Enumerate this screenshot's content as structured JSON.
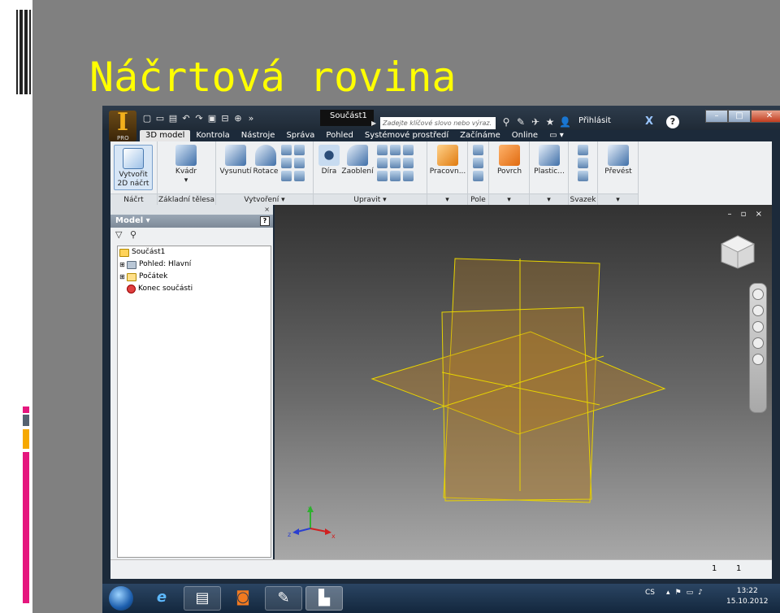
{
  "slide": {
    "title": "Náčrtová rovina"
  },
  "app": {
    "badge": "PRO",
    "doc_title": "Součást1",
    "search_placeholder": "Zadejte klíčové slovo nebo výraz.",
    "signin_label": "Přihlásit",
    "help_label": "?"
  },
  "menu": {
    "tabs": [
      "3D model",
      "Kontrola",
      "Nástroje",
      "Správa",
      "Pohled",
      "Systémové prostředí",
      "Začínáme",
      "Online"
    ],
    "active_index": 0
  },
  "ribbon": {
    "sketch": {
      "btn_line1": "Vytvořit",
      "btn_line2": "2D náčrt",
      "group": "Náčrt"
    },
    "primitives": {
      "btn": "Kvádr",
      "group": "Základní tělesa"
    },
    "create": {
      "extrude": "Vysunutí",
      "revolve": "Rotace",
      "group": "Vytvoření"
    },
    "modify": {
      "hole": "Díra",
      "fillet": "Zaoblení",
      "group": "Upravit"
    },
    "work": {
      "btn": "Pracovn...",
      "group": ""
    },
    "pattern": {
      "group": "Pole"
    },
    "surface": {
      "btn": "Povrch",
      "group": ""
    },
    "plastic": {
      "btn": "Plastic...",
      "group": ""
    },
    "harness": {
      "group": "Svazek"
    },
    "convert": {
      "btn": "Převést",
      "group": ""
    }
  },
  "browser": {
    "pin": "×",
    "header": "Model",
    "help": "?",
    "tree": [
      {
        "label": "Součást1",
        "icon": "part-icon"
      },
      {
        "label": "Pohled: Hlavní",
        "icon": "view-icon"
      },
      {
        "label": "Počátek",
        "icon": "folder-icon"
      },
      {
        "label": "Konec součásti",
        "icon": "end-of-part-icon"
      }
    ]
  },
  "viewport": {
    "window_controls": "– ▫ ×"
  },
  "status": {
    "left": "1",
    "right": "1"
  },
  "taskbar": {
    "lang": "CS",
    "time": "13:22",
    "date": "15.10.2012"
  },
  "colors": {
    "slide_title": "#ffff00",
    "plane_edge": "#e8d400",
    "plane_fill": "#b07a28"
  }
}
